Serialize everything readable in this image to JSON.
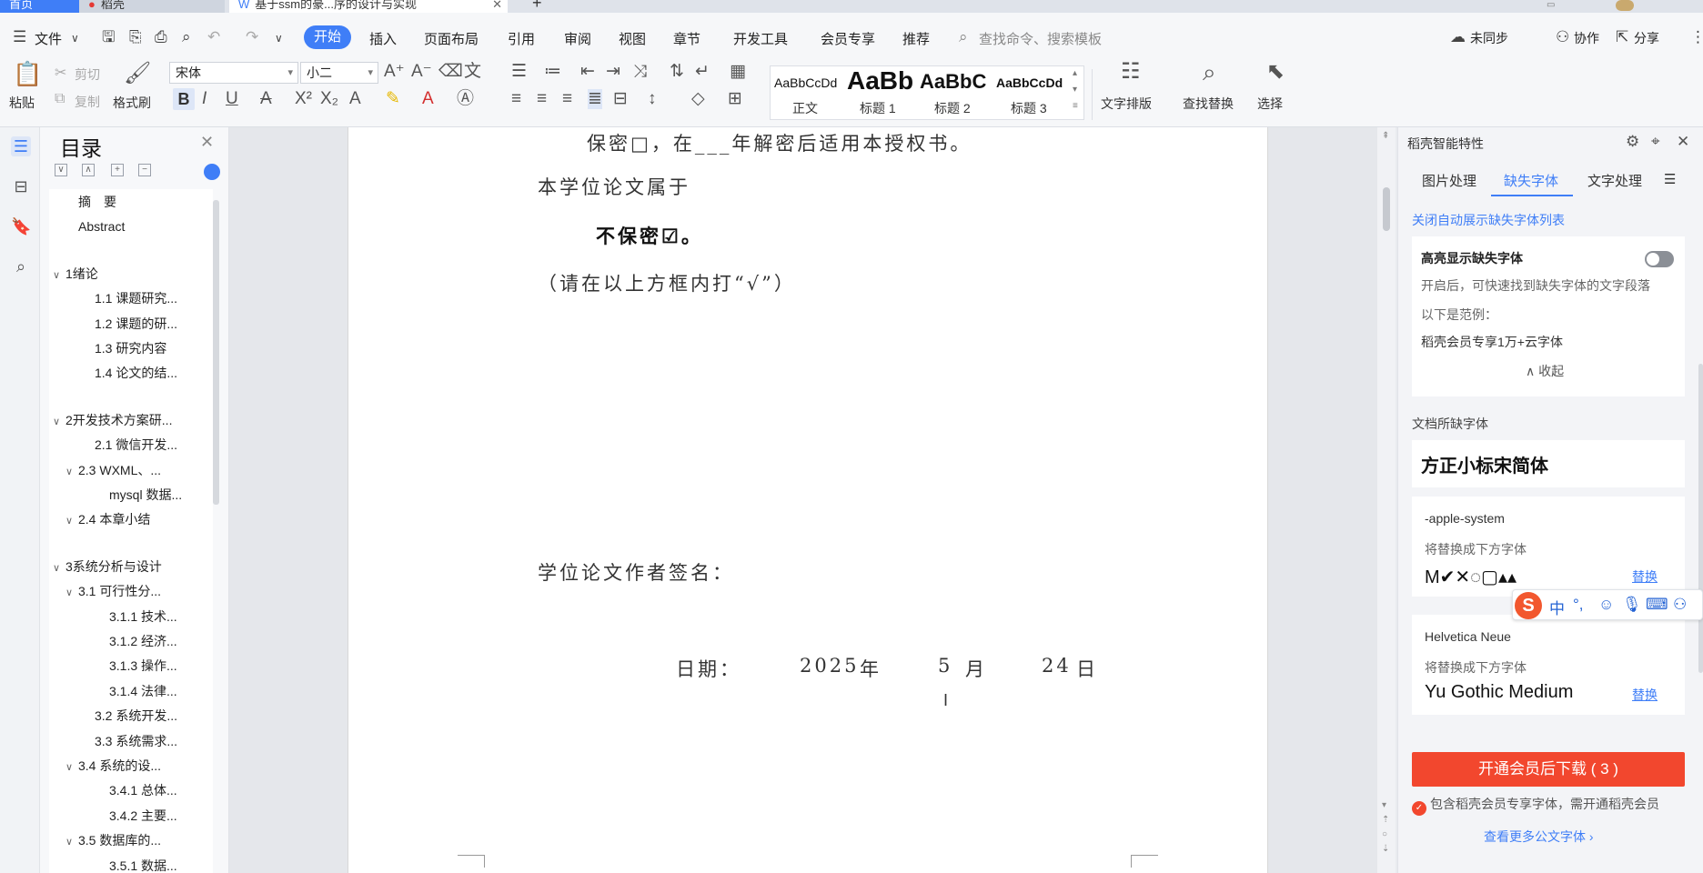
{
  "tabs": {
    "home": "首页",
    "daoke": "稻壳",
    "doc": "基于ssm的豪...序的设计与实现",
    "add": "+"
  },
  "menu": {
    "file": "文件",
    "items": [
      "开始",
      "插入",
      "页面布局",
      "引用",
      "审阅",
      "视图",
      "章节",
      "开发工具",
      "会员专享",
      "推荐"
    ],
    "search_placeholder": "查找命令、搜索模板",
    "sync": "未同步",
    "collab": "协作",
    "share": "分享"
  },
  "ribbon": {
    "paste": "粘贴",
    "cut": "剪切",
    "copy": "复制",
    "format_painter": "格式刷",
    "font_name": "宋体",
    "font_size": "小二",
    "styles": [
      {
        "preview": "AaBbCcDd",
        "name": "正文"
      },
      {
        "preview": "AaBb",
        "name": "标题 1"
      },
      {
        "preview": "AaBbC",
        "name": "标题 2"
      },
      {
        "preview": "AaBbCcDd",
        "name": "标题 3"
      }
    ],
    "text_layout": "文字排版",
    "find_replace": "查找替换",
    "select": "选择"
  },
  "toc": {
    "title": "目录",
    "items": [
      {
        "label": "摘　要",
        "level": 1,
        "caret": ""
      },
      {
        "label": "Abstract",
        "level": 1,
        "caret": ""
      },
      {
        "label": "1绪论",
        "level": 0,
        "caret": "∨"
      },
      {
        "label": "1.1  课题研究...",
        "level": 2,
        "caret": ""
      },
      {
        "label": "1.2  课题的研...",
        "level": 2,
        "caret": ""
      },
      {
        "label": "1.3  研究内容",
        "level": 2,
        "caret": ""
      },
      {
        "label": "1.4  论文的结...",
        "level": 2,
        "caret": ""
      },
      {
        "label": "2开发技术方案研...",
        "level": 0,
        "caret": "∨"
      },
      {
        "label": "2.1  微信开发...",
        "level": 2,
        "caret": ""
      },
      {
        "label": "2.3 WXML、...",
        "level": 1,
        "caret": "∨"
      },
      {
        "label": "mysql 数据...",
        "level": 3,
        "caret": ""
      },
      {
        "label": "2.4  本章小结",
        "level": 1,
        "caret": "∨"
      },
      {
        "label": "3系统分析与设计",
        "level": 0,
        "caret": "∨"
      },
      {
        "label": "3.1  可行性分...",
        "level": 1,
        "caret": "∨"
      },
      {
        "label": "3.1.1  技术...",
        "level": 3,
        "caret": ""
      },
      {
        "label": "3.1.2  经济...",
        "level": 3,
        "caret": ""
      },
      {
        "label": "3.1.3  操作...",
        "level": 3,
        "caret": ""
      },
      {
        "label": "3.1.4  法律...",
        "level": 3,
        "caret": ""
      },
      {
        "label": "3.2  系统开发...",
        "level": 2,
        "caret": ""
      },
      {
        "label": "3.3  系统需求...",
        "level": 2,
        "caret": ""
      },
      {
        "label": "3.4  系统的设...",
        "level": 1,
        "caret": "∨"
      },
      {
        "label": "3.4.1  总体...",
        "level": 3,
        "caret": ""
      },
      {
        "label": "3.4.2  主要...",
        "level": 3,
        "caret": ""
      },
      {
        "label": "3.5  数据库的...",
        "level": 1,
        "caret": "∨"
      },
      {
        "label": "3.5.1  数据...",
        "level": 3,
        "caret": ""
      }
    ]
  },
  "document": {
    "line1": "保密□，在___年解密后适用本授权书。",
    "line2": "本学位论文属于",
    "line3": "不保密☑。",
    "line4": "（请在以上方框内打“√”）",
    "signature": "学位论文作者签名：",
    "date_label": "日期：",
    "year": "2025",
    "year_unit": "年",
    "month": "5",
    "month_unit": "月",
    "day": "24",
    "day_unit": "日"
  },
  "panel": {
    "title": "稻壳智能特性",
    "tabs": [
      "图片处理",
      "缺失字体",
      "文字处理"
    ],
    "close_auto_link": "关闭自动展示缺失字体列表",
    "highlight_title": "高亮显示缺失字体",
    "highlight_desc": "开启后，可快速找到缺失字体的文字段落",
    "example_label": "以下是范例：",
    "example_text": "稻壳会员专享1万+云字体",
    "collapse": "收起",
    "missing_label": "文档所缺字体",
    "missing_main_font": "方正小标宋简体",
    "font_card_1": {
      "name": "-apple-system",
      "hint": "将替换成下方字体",
      "replacement": "M✔✕◌▢▴▴",
      "action": "替换"
    },
    "font_card_2": {
      "name": "Helvetica Neue",
      "hint": "将替换成下方字体",
      "replacement": "Yu Gothic Medium",
      "action": "替换"
    },
    "download_button": "开通会员后下载 ( 3 )",
    "note": "包含稻壳会员专享字体，需开通稻壳会员",
    "more_link": "查看更多公文字体 ›"
  },
  "ime": {
    "logo": "S",
    "mode": "中",
    "punct": "°,"
  },
  "colors": {
    "accent": "#3f7ef7",
    "download": "#f2472e"
  }
}
